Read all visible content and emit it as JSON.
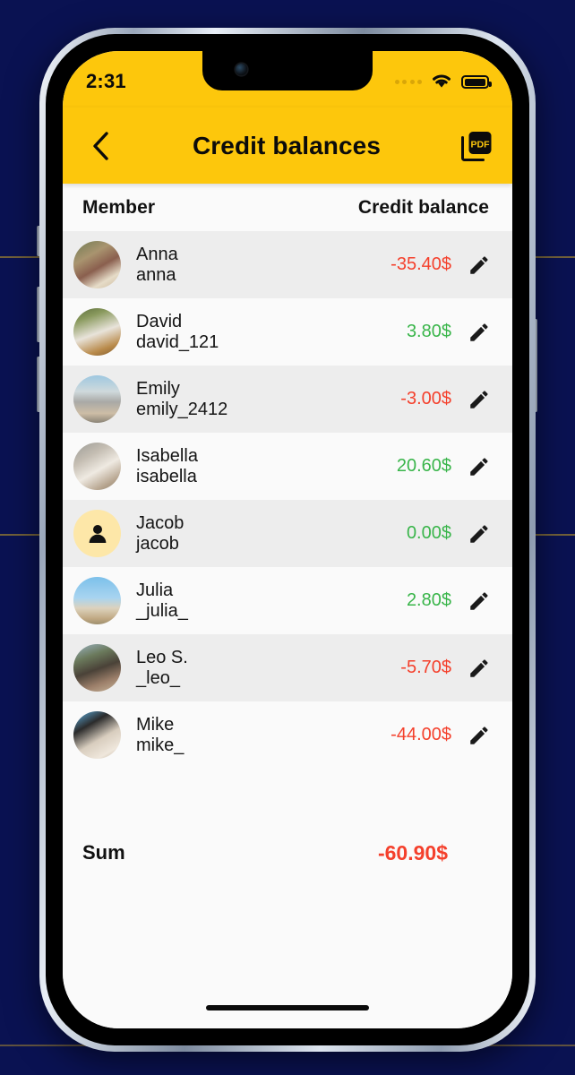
{
  "status_bar": {
    "clock": "2:31",
    "signal_icon": "signal-dots-icon",
    "wifi_icon": "wifi-icon",
    "battery_icon": "battery-full-icon"
  },
  "nav": {
    "back_icon": "chevron-left-icon",
    "title": "Credit balances",
    "pdf_icon": "pdf-export-icon",
    "pdf_label": "PDF"
  },
  "table": {
    "columns": {
      "member": "Member",
      "balance": "Credit balance"
    },
    "rows": [
      {
        "name": "Anna",
        "username": "anna",
        "balance": "-35.40$",
        "sign": "neg",
        "avatar": "photo",
        "edit_icon": "pencil-icon"
      },
      {
        "name": "David",
        "username": "david_121",
        "balance": "3.80$",
        "sign": "pos",
        "avatar": "photo",
        "edit_icon": "pencil-icon"
      },
      {
        "name": "Emily",
        "username": "emily_2412",
        "balance": "-3.00$",
        "sign": "neg",
        "avatar": "photo",
        "edit_icon": "pencil-icon"
      },
      {
        "name": "Isabella",
        "username": "isabella",
        "balance": "20.60$",
        "sign": "pos",
        "avatar": "photo",
        "edit_icon": "pencil-icon"
      },
      {
        "name": "Jacob",
        "username": "jacob",
        "balance": "0.00$",
        "sign": "pos",
        "avatar": "placeholder",
        "edit_icon": "pencil-icon"
      },
      {
        "name": "Julia",
        "username": "_julia_",
        "balance": "2.80$",
        "sign": "pos",
        "avatar": "photo",
        "edit_icon": "pencil-icon"
      },
      {
        "name": "Leo S.",
        "username": "_leo_",
        "balance": "-5.70$",
        "sign": "neg",
        "avatar": "photo",
        "edit_icon": "pencil-icon"
      },
      {
        "name": "Mike",
        "username": "mike_",
        "balance": "-44.00$",
        "sign": "neg",
        "avatar": "photo",
        "edit_icon": "pencil-icon"
      }
    ],
    "summary": {
      "label": "Sum",
      "value": "-60.90$",
      "sign": "neg"
    }
  },
  "colors": {
    "accent_yellow": "#FDC70C",
    "negative": "#F4402C",
    "positive": "#39B54A",
    "row_alt": "#EDEDED",
    "row_base": "#FAFAFA",
    "page_background": "#0A1252"
  }
}
